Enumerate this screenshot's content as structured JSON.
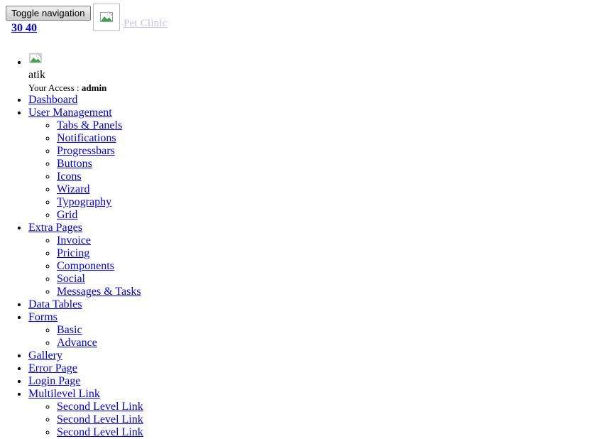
{
  "header": {
    "toggle_button_label": "Toggle navigation",
    "logo_icon": "broken-image-icon",
    "brand_link_label": "Pet Clinic",
    "count_link_label": "30 40"
  },
  "user": {
    "avatar_icon": "broken-image-icon",
    "name": "atik",
    "access_label": "Your Access :",
    "access_value": "admin"
  },
  "nav": {
    "items": [
      {
        "label": "Dashboard",
        "children": []
      },
      {
        "label": "User Management",
        "children": [
          {
            "label": "Tabs & Panels"
          },
          {
            "label": "Notifications"
          },
          {
            "label": "Progressbars"
          },
          {
            "label": "Buttons"
          },
          {
            "label": "Icons"
          },
          {
            "label": "Wizard"
          },
          {
            "label": "Typography"
          },
          {
            "label": "Grid"
          }
        ]
      },
      {
        "label": "Extra Pages",
        "children": [
          {
            "label": "Invoice"
          },
          {
            "label": "Pricing"
          },
          {
            "label": "Components"
          },
          {
            "label": "Social"
          },
          {
            "label": "Messages & Tasks"
          }
        ]
      },
      {
        "label": "Data Tables",
        "children": []
      },
      {
        "label": "Forms",
        "children": [
          {
            "label": "Basic"
          },
          {
            "label": "Advance"
          }
        ]
      },
      {
        "label": "Gallery",
        "children": []
      },
      {
        "label": "Error Page",
        "children": []
      },
      {
        "label": "Login Page",
        "children": []
      },
      {
        "label": "Multilevel Link",
        "children": [
          {
            "label": "Second Level Link"
          },
          {
            "label": "Second Level Link"
          },
          {
            "label": "Second Level Link"
          }
        ]
      }
    ]
  },
  "colors": {
    "link": "#0000ee",
    "text": "#000000",
    "background": "#ffffff"
  }
}
